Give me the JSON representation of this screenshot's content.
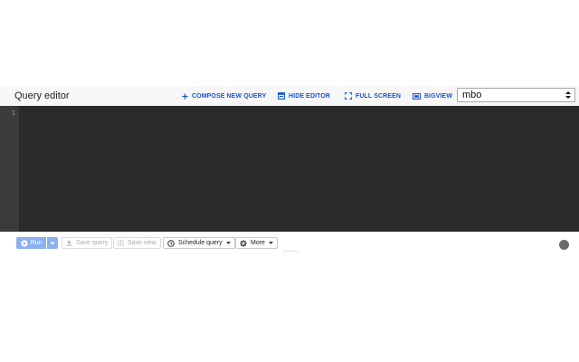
{
  "header": {
    "title": "Query editor",
    "compose_label": "COMPOSE NEW QUERY",
    "hide_editor_label": "HIDE EDITOR",
    "full_screen_label": "FULL SCREEN",
    "bigview_label": "BIGVIEW",
    "project_select_value": "mbo"
  },
  "editor": {
    "line_numbers": [
      "1"
    ]
  },
  "toolbar": {
    "run_label": "Run",
    "save_query_label": "Save query",
    "save_view_label": "Save view",
    "schedule_query_label": "Schedule query",
    "more_label": "More"
  },
  "colors": {
    "accent": "#1a56c8",
    "run_button": "#8bb0ee",
    "editor_bg": "#2b2b2b",
    "gutter_bg": "#3b3b3b"
  },
  "icons": {
    "compose": "plus-icon",
    "hide_editor": "editor-panel-icon",
    "full_screen": "fullscreen-icon",
    "bigview": "bigview-icon",
    "run": "play-circle-icon",
    "save_query": "upload-icon",
    "save_view": "grid-icon",
    "schedule_query": "clock-icon",
    "more": "gear-icon"
  }
}
